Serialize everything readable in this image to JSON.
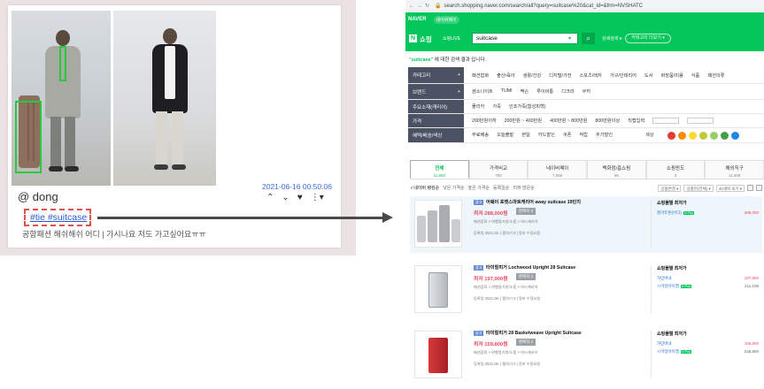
{
  "post": {
    "date": "2021-06-16 00:50:06",
    "username": "@ dong",
    "hashtags": "#tie #suitcase",
    "caption": "공항패션 해쉬해쉬 어디 | 가시나요 저도 가고싶어요ㅠㅠ",
    "actions": [
      "chevron-up-icon",
      "chevron-down-icon",
      "heart-icon",
      "more-icon"
    ]
  },
  "browser": {
    "url": "search.shopping.naver.com/search/all?query=suitcase%20&cat_id=&frm=NVSHATC",
    "naver_logo": "NAVER",
    "naver_menu": "네이버페이",
    "shop_title": "쇼핑",
    "shop_live": "쇼핑LIVE",
    "search_value": "suitcase",
    "detail_search": "상세검색 ▾",
    "category_btn": "카테고리 더보기 ▾",
    "result_keyword": "\"suitcase\"",
    "result_text": " 에 대한 검색 결과 입니다.",
    "filters": [
      {
        "label": "카테고리",
        "items": [
          "패션잡화",
          "출산/육아",
          "생활/건강",
          "디지털/가전",
          "스포츠/레저",
          "가구/인테리어",
          "도서",
          "화장품/미용",
          "식품",
          "패션의류"
        ]
      },
      {
        "label": "브랜드",
        "items": [
          "샘소나이트",
          "TUMI",
          "맥슨",
          "루이비통",
          "디크라",
          "쿠히"
        ]
      },
      {
        "label": "주요소재(캐리어)",
        "items": [
          "폴리카",
          "가죽",
          "인조가죽(합성피혁)"
        ]
      },
      {
        "label": "가격",
        "items": [
          "200만원이하",
          "200만원 ~ 400만원",
          "400만원 ~ 800만원",
          "800만원이상",
          "직접입력"
        ]
      },
      {
        "label": "혜택/배송/색상",
        "items": [
          "무료배송",
          "오늘출발",
          "현일",
          "카드할인",
          "쿠폰",
          "적립",
          "추가할인",
          "색상"
        ]
      }
    ],
    "colors": [
      "#e53935",
      "#fb8c00",
      "#fdd835",
      "#c0ca33",
      "#9ccc65",
      "#43a047",
      "#1e88e5"
    ],
    "tabs": [
      {
        "label": "전체",
        "count": "11,850"
      },
      {
        "label": "가격비교",
        "count": "700"
      },
      {
        "label": "네이버페이",
        "count": "7,550"
      },
      {
        "label": "백화점/홈쇼핑",
        "count": "96"
      },
      {
        "label": "쇼핑윈도",
        "count": "3"
      },
      {
        "label": "해외직구",
        "count": "11,609"
      }
    ],
    "sort_options": [
      "✓네이버 랭킹순",
      "낮은 가격순",
      "높은 가격순",
      "등록일순",
      "리뷰 많은순"
    ],
    "sort_right": [
      "상품변경 ▾",
      "상품만(전체) ▾",
      "40개씩 보기 ▾"
    ],
    "items": [
      {
        "badge": "광고",
        "title": "어웨이 포켓스마트캐리어 away suitcase 19인치",
        "price": "최저 288,000원",
        "compare": "판매처 2",
        "category": "패션잡화 > 여행용가방/소품 > 하드캐리어",
        "meta": "등록일 2021.03. | 찜하기 0 | 정보 수정요청",
        "mall_title": "쇼핑몰별 최저가",
        "malls": [
          {
            "name": "홈마트본(어디)",
            "price": "288,000"
          }
        ]
      },
      {
        "badge": "광고",
        "title": "타미힐피거 Lochwood Upright 28 Suitcase",
        "price": "최저 197,900원",
        "compare": "판매처 2",
        "category": "패션잡화 > 여행용가방/소품 > 하드캐리어",
        "meta": "등록일 2021.06. | 찜하기 0 | 정보 수정요청",
        "mall_title": "쇼핑몰별 최저가",
        "malls": [
          {
            "name": "하민버내",
            "price": "197,900"
          },
          {
            "name": "스마일아이맵",
            "price": "211,108"
          }
        ]
      },
      {
        "badge": "광고",
        "title": "타미힐피거 28 Basketweave Upright Suitcase",
        "price": "최저 159,800원",
        "compare": "판매처 2",
        "category": "패션잡화 > 여행용가방/소품 > 하드캐리어",
        "meta": "등록일 2021.05. | 찜하기 0 | 정보 수정요청",
        "mall_title": "쇼핑몰별 최저가",
        "malls": [
          {
            "name": "하민버내",
            "price": "159,800"
          },
          {
            "name": "스마일아이맵",
            "price": "226,800"
          }
        ]
      }
    ]
  }
}
